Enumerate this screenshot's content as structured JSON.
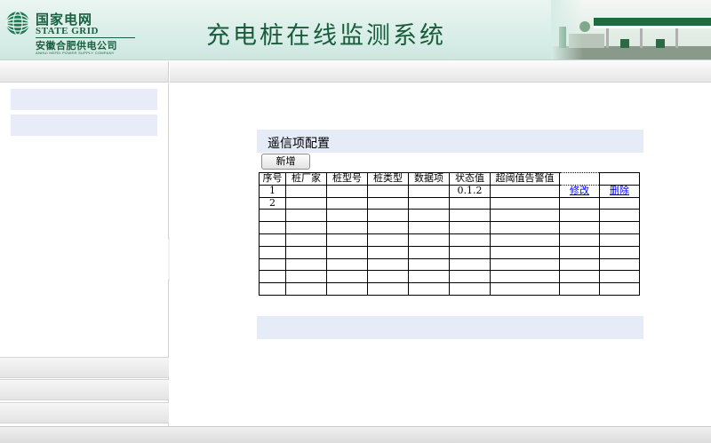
{
  "header": {
    "logo": {
      "name_cn": "国家电网",
      "name_en": "STATE GRID",
      "company_cn": "安徽合肥供电公司",
      "company_en": "ANHUI HEFEI POWER SUPPLY COMPANY"
    },
    "system_title": "充电桩在线监测系统"
  },
  "main": {
    "section_title": "遥信项配置",
    "add_button_label": "新增",
    "table": {
      "columns": [
        "序号",
        "桩厂家",
        "桩型号",
        "桩类型",
        "数据项",
        "状态值",
        "超阈值告警值",
        "",
        ""
      ],
      "rows": [
        {
          "index": "1",
          "manufacturer": "",
          "model": "",
          "type": "",
          "data_item": "",
          "status_value": "0.1.2",
          "alarm_value": "",
          "edit": "修改",
          "delete": "删除"
        },
        {
          "index": "2",
          "manufacturer": "",
          "model": "",
          "type": "",
          "data_item": "",
          "status_value": "",
          "alarm_value": "",
          "edit": "",
          "delete": ""
        },
        {
          "index": "",
          "manufacturer": "",
          "model": "",
          "type": "",
          "data_item": "",
          "status_value": "",
          "alarm_value": "",
          "edit": "",
          "delete": ""
        },
        {
          "index": "",
          "manufacturer": "",
          "model": "",
          "type": "",
          "data_item": "",
          "status_value": "",
          "alarm_value": "",
          "edit": "",
          "delete": ""
        },
        {
          "index": "",
          "manufacturer": "",
          "model": "",
          "type": "",
          "data_item": "",
          "status_value": "",
          "alarm_value": "",
          "edit": "",
          "delete": ""
        },
        {
          "index": "",
          "manufacturer": "",
          "model": "",
          "type": "",
          "data_item": "",
          "status_value": "",
          "alarm_value": "",
          "edit": "",
          "delete": ""
        },
        {
          "index": "",
          "manufacturer": "",
          "model": "",
          "type": "",
          "data_item": "",
          "status_value": "",
          "alarm_value": "",
          "edit": "",
          "delete": ""
        },
        {
          "index": "",
          "manufacturer": "",
          "model": "",
          "type": "",
          "data_item": "",
          "status_value": "",
          "alarm_value": "",
          "edit": "",
          "delete": ""
        },
        {
          "index": "",
          "manufacturer": "",
          "model": "",
          "type": "",
          "data_item": "",
          "status_value": "",
          "alarm_value": "",
          "edit": "",
          "delete": ""
        }
      ]
    }
  },
  "sidebar": {
    "collapse_icon": "chevron-left-icon",
    "collapse_glyph": "‹"
  },
  "colors": {
    "brand_green": "#18603f",
    "section_bg": "#e6ebf8",
    "link_blue": "#0000ff"
  }
}
